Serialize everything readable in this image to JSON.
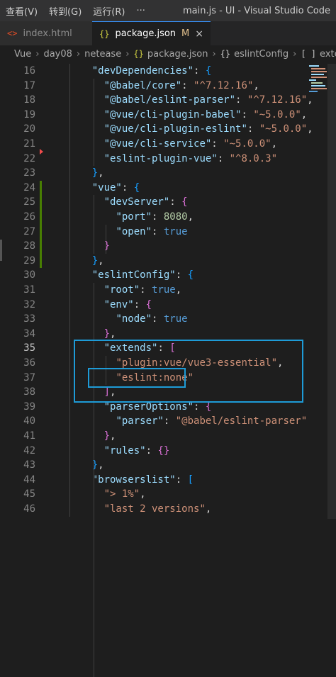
{
  "menubar": {
    "items": [
      "查看(V)",
      "转到(G)",
      "运行(R)",
      "···"
    ],
    "window_title": "main.js - UI - Visual Studio Code"
  },
  "tabs": [
    {
      "icon": "<>",
      "label": "index.html",
      "active": false,
      "close": ""
    },
    {
      "icon": "{}",
      "label": "package.json",
      "active": true,
      "modified": "M",
      "close": "×"
    }
  ],
  "breadcrumb": {
    "parts": [
      "Vue",
      "day08",
      "netease"
    ],
    "file": "package.json",
    "node": "eslintConfig",
    "array": "extends",
    "file_icon": "{}",
    "node_icon": "{}",
    "array_icon": "[ ]"
  },
  "code": {
    "current_line": 35,
    "lines": [
      {
        "n": "16",
        "t": [
          [
            "    ",
            "p"
          ],
          [
            "\"devDependencies\"",
            "k"
          ],
          [
            ": ",
            "p"
          ],
          [
            "{",
            "br2"
          ]
        ]
      },
      {
        "n": "17",
        "t": [
          [
            "      ",
            "p"
          ],
          [
            "\"@babel/core\"",
            "k"
          ],
          [
            ": ",
            "p"
          ],
          [
            "\"^7.12.16\"",
            "s"
          ],
          [
            ",",
            "p"
          ]
        ]
      },
      {
        "n": "18",
        "t": [
          [
            "      ",
            "p"
          ],
          [
            "\"@babel/eslint-parser\"",
            "k"
          ],
          [
            ": ",
            "p"
          ],
          [
            "\"^7.12.16\"",
            "s"
          ],
          [
            ",",
            "p"
          ]
        ]
      },
      {
        "n": "19",
        "t": [
          [
            "      ",
            "p"
          ],
          [
            "\"@vue/cli-plugin-babel\"",
            "k"
          ],
          [
            ": ",
            "p"
          ],
          [
            "\"~5.0.0\"",
            "s"
          ],
          [
            ",",
            "p"
          ]
        ]
      },
      {
        "n": "20",
        "t": [
          [
            "      ",
            "p"
          ],
          [
            "\"@vue/cli-plugin-eslint\"",
            "k"
          ],
          [
            ": ",
            "p"
          ],
          [
            "\"~5.0.0\"",
            "s"
          ],
          [
            ",",
            "p"
          ]
        ]
      },
      {
        "n": "21",
        "t": [
          [
            "      ",
            "p"
          ],
          [
            "\"@vue/cli-service\"",
            "k"
          ],
          [
            ": ",
            "p"
          ],
          [
            "\"~5.0.0\"",
            "s"
          ],
          [
            ",",
            "p"
          ]
        ]
      },
      {
        "n": "22",
        "t": [
          [
            "      ",
            "p"
          ],
          [
            "\"eslint-plugin-vue\"",
            "k"
          ],
          [
            ": ",
            "p"
          ],
          [
            "\"^8.0.3\"",
            "s"
          ]
        ]
      },
      {
        "n": "23",
        "t": [
          [
            "    ",
            "p"
          ],
          [
            "}",
            "br2"
          ],
          [
            ",",
            "p"
          ]
        ]
      },
      {
        "n": "24",
        "t": [
          [
            "    ",
            "p"
          ],
          [
            "\"vue\"",
            "k"
          ],
          [
            ": ",
            "p"
          ],
          [
            "{",
            "br2"
          ]
        ]
      },
      {
        "n": "25",
        "t": [
          [
            "      ",
            "p"
          ],
          [
            "\"devServer\"",
            "k"
          ],
          [
            ": ",
            "p"
          ],
          [
            "{",
            "br1"
          ]
        ]
      },
      {
        "n": "26",
        "t": [
          [
            "        ",
            "p"
          ],
          [
            "\"port\"",
            "k"
          ],
          [
            ": ",
            "p"
          ],
          [
            "8080",
            "n"
          ],
          [
            ",",
            "p"
          ]
        ]
      },
      {
        "n": "27",
        "t": [
          [
            "        ",
            "p"
          ],
          [
            "\"open\"",
            "k"
          ],
          [
            ": ",
            "p"
          ],
          [
            "true",
            "b"
          ]
        ]
      },
      {
        "n": "28",
        "t": [
          [
            "      ",
            "p"
          ],
          [
            "}",
            "br1"
          ]
        ]
      },
      {
        "n": "29",
        "t": [
          [
            "    ",
            "p"
          ],
          [
            "}",
            "br2"
          ],
          [
            ",",
            "p"
          ]
        ]
      },
      {
        "n": "30",
        "t": [
          [
            "    ",
            "p"
          ],
          [
            "\"eslintConfig\"",
            "k"
          ],
          [
            ": ",
            "p"
          ],
          [
            "{",
            "br2"
          ]
        ]
      },
      {
        "n": "31",
        "t": [
          [
            "      ",
            "p"
          ],
          [
            "\"root\"",
            "k"
          ],
          [
            ": ",
            "p"
          ],
          [
            "true",
            "b"
          ],
          [
            ",",
            "p"
          ]
        ]
      },
      {
        "n": "32",
        "t": [
          [
            "      ",
            "p"
          ],
          [
            "\"env\"",
            "k"
          ],
          [
            ": ",
            "p"
          ],
          [
            "{",
            "br1"
          ]
        ]
      },
      {
        "n": "33",
        "t": [
          [
            "        ",
            "p"
          ],
          [
            "\"node\"",
            "k"
          ],
          [
            ": ",
            "p"
          ],
          [
            "true",
            "b"
          ]
        ]
      },
      {
        "n": "34",
        "t": [
          [
            "      ",
            "p"
          ],
          [
            "}",
            "br1"
          ],
          [
            ",",
            "p"
          ]
        ]
      },
      {
        "n": "35",
        "t": [
          [
            "      ",
            "p"
          ],
          [
            "\"extends\"",
            "k"
          ],
          [
            ": ",
            "p"
          ],
          [
            "[",
            "br1"
          ]
        ]
      },
      {
        "n": "36",
        "t": [
          [
            "        ",
            "p"
          ],
          [
            "\"plugin:vue/vue3-essential\"",
            "s"
          ],
          [
            ",",
            "p"
          ]
        ]
      },
      {
        "n": "37",
        "t": [
          [
            "        ",
            "p"
          ],
          [
            "\"eslint:none\"",
            "s"
          ]
        ]
      },
      {
        "n": "38",
        "t": [
          [
            "      ",
            "p"
          ],
          [
            "]",
            "br1"
          ],
          [
            ",",
            "p"
          ]
        ]
      },
      {
        "n": "39",
        "t": [
          [
            "      ",
            "p"
          ],
          [
            "\"parserOptions\"",
            "k"
          ],
          [
            ": ",
            "p"
          ],
          [
            "{",
            "br1"
          ]
        ]
      },
      {
        "n": "40",
        "t": [
          [
            "        ",
            "p"
          ],
          [
            "\"parser\"",
            "k"
          ],
          [
            ": ",
            "p"
          ],
          [
            "\"@babel/eslint-parser\"",
            "s"
          ]
        ]
      },
      {
        "n": "41",
        "t": [
          [
            "      ",
            "p"
          ],
          [
            "}",
            "br1"
          ],
          [
            ",",
            "p"
          ]
        ]
      },
      {
        "n": "42",
        "t": [
          [
            "      ",
            "p"
          ],
          [
            "\"rules\"",
            "k"
          ],
          [
            ": ",
            "p"
          ],
          [
            "{}",
            "br1"
          ]
        ]
      },
      {
        "n": "43",
        "t": [
          [
            "    ",
            "p"
          ],
          [
            "}",
            "br2"
          ],
          [
            ",",
            "p"
          ]
        ]
      },
      {
        "n": "44",
        "t": [
          [
            "    ",
            "p"
          ],
          [
            "\"browserslist\"",
            "k"
          ],
          [
            ": ",
            "p"
          ],
          [
            "[",
            "br2"
          ]
        ]
      },
      {
        "n": "45",
        "t": [
          [
            "      ",
            "p"
          ],
          [
            "\"> 1%\"",
            "s"
          ],
          [
            ",",
            "p"
          ]
        ]
      },
      {
        "n": "46",
        "t": [
          [
            "      ",
            "p"
          ],
          [
            "\"last 2 versions\"",
            "s"
          ],
          [
            ",",
            "p"
          ]
        ]
      }
    ]
  },
  "colors": {
    "accent": "#3794ff",
    "highlight_box": "#1e9bd7",
    "git_added": "#487e02",
    "git_deleted": "#f14c4c"
  }
}
